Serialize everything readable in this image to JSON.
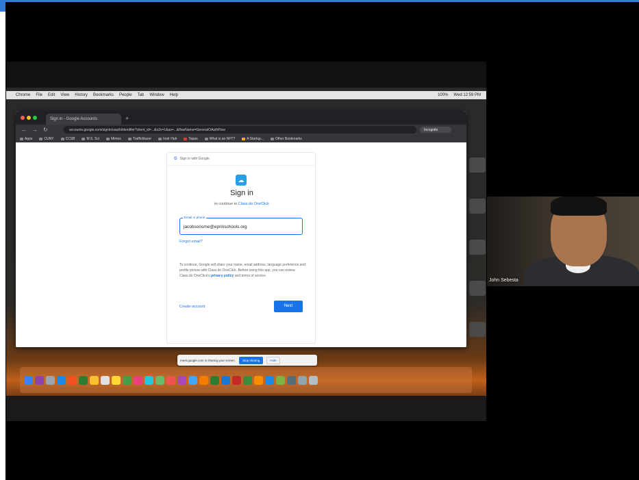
{
  "menubar": {
    "apple": "",
    "items": [
      "Chrome",
      "File",
      "Edit",
      "View",
      "History",
      "Bookmarks",
      "People",
      "Tab",
      "Window",
      "Help"
    ],
    "right_items": [
      "100%",
      "Wed 12:59 PM"
    ]
  },
  "browser": {
    "tab_title": "Sign in - Google Accounts",
    "new_tab": "+",
    "url": "accounts.google.com/signin/oauth/identifier?client_id=...&o2v=1&as=...&flowName=GeneralOAuthFlow",
    "incognito_label": "Incognito",
    "bookmarks": [
      "Apps",
      "CUNY",
      "CCSB",
      "M.S. Sci",
      "Mimos",
      "Trafficblazer",
      "Instr Hub",
      "Tapas",
      "What is an NFT?",
      "A Startup...",
      "Other Bookmarks"
    ]
  },
  "signin": {
    "header": "Sign in with Google",
    "header_g": "G",
    "logo_glyph": "☁",
    "title": "Sign in",
    "continue_prefix": "to continue to ",
    "continue_app": "Class.do OneClick",
    "email_label": "Email or phone",
    "email_value": "jacobsonsme@eprinschools.org",
    "forgot": "Forgot email?",
    "note_prefix": "To continue, Google will share your name, email address, language preference and profile picture with Class.do OneClick. Before using this app, you can review Class.do OneClick's ",
    "note_link": "privacy policy",
    "note_suffix": " and terms of service.",
    "create_account": "Create account",
    "next": "Next"
  },
  "sharebar": {
    "text": "meet.google.com is sharing your screen.",
    "stop": "Stop sharing",
    "hide": "Hide"
  },
  "video": {
    "participant_name": "John Sebesta"
  }
}
